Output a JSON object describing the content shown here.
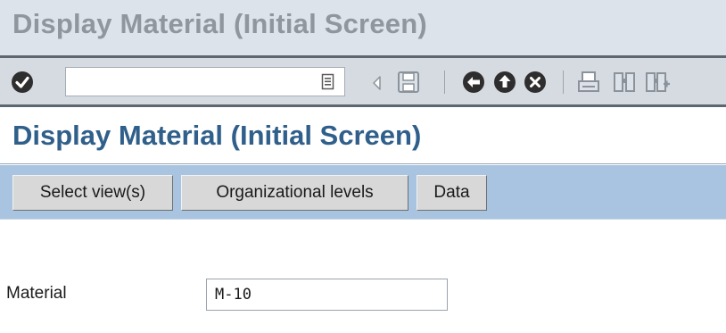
{
  "window": {
    "title": "Display Material (Initial Screen)"
  },
  "toolbar": {
    "command_field_value": "",
    "icons": [
      "enter-icon",
      "command-history-icon",
      "collapse-left-icon",
      "save-icon",
      "back-icon",
      "exit-icon",
      "cancel-icon",
      "print-icon",
      "find-icon",
      "find-next-icon"
    ]
  },
  "screen": {
    "title": "Display Material (Initial Screen)"
  },
  "app_toolbar": {
    "select_views_label": "Select view(s)",
    "org_levels_label": "Organizational levels",
    "data_label": "Data"
  },
  "form": {
    "material_label": "Material",
    "material_value": "M-10"
  },
  "colors": {
    "title_bar_bg": "#dde3ea",
    "title_bar_text": "#8f969e",
    "screen_title_text": "#2f5f8a",
    "app_toolbar_bg": "#a8c4e0",
    "button_bg": "#d8d8d8"
  }
}
